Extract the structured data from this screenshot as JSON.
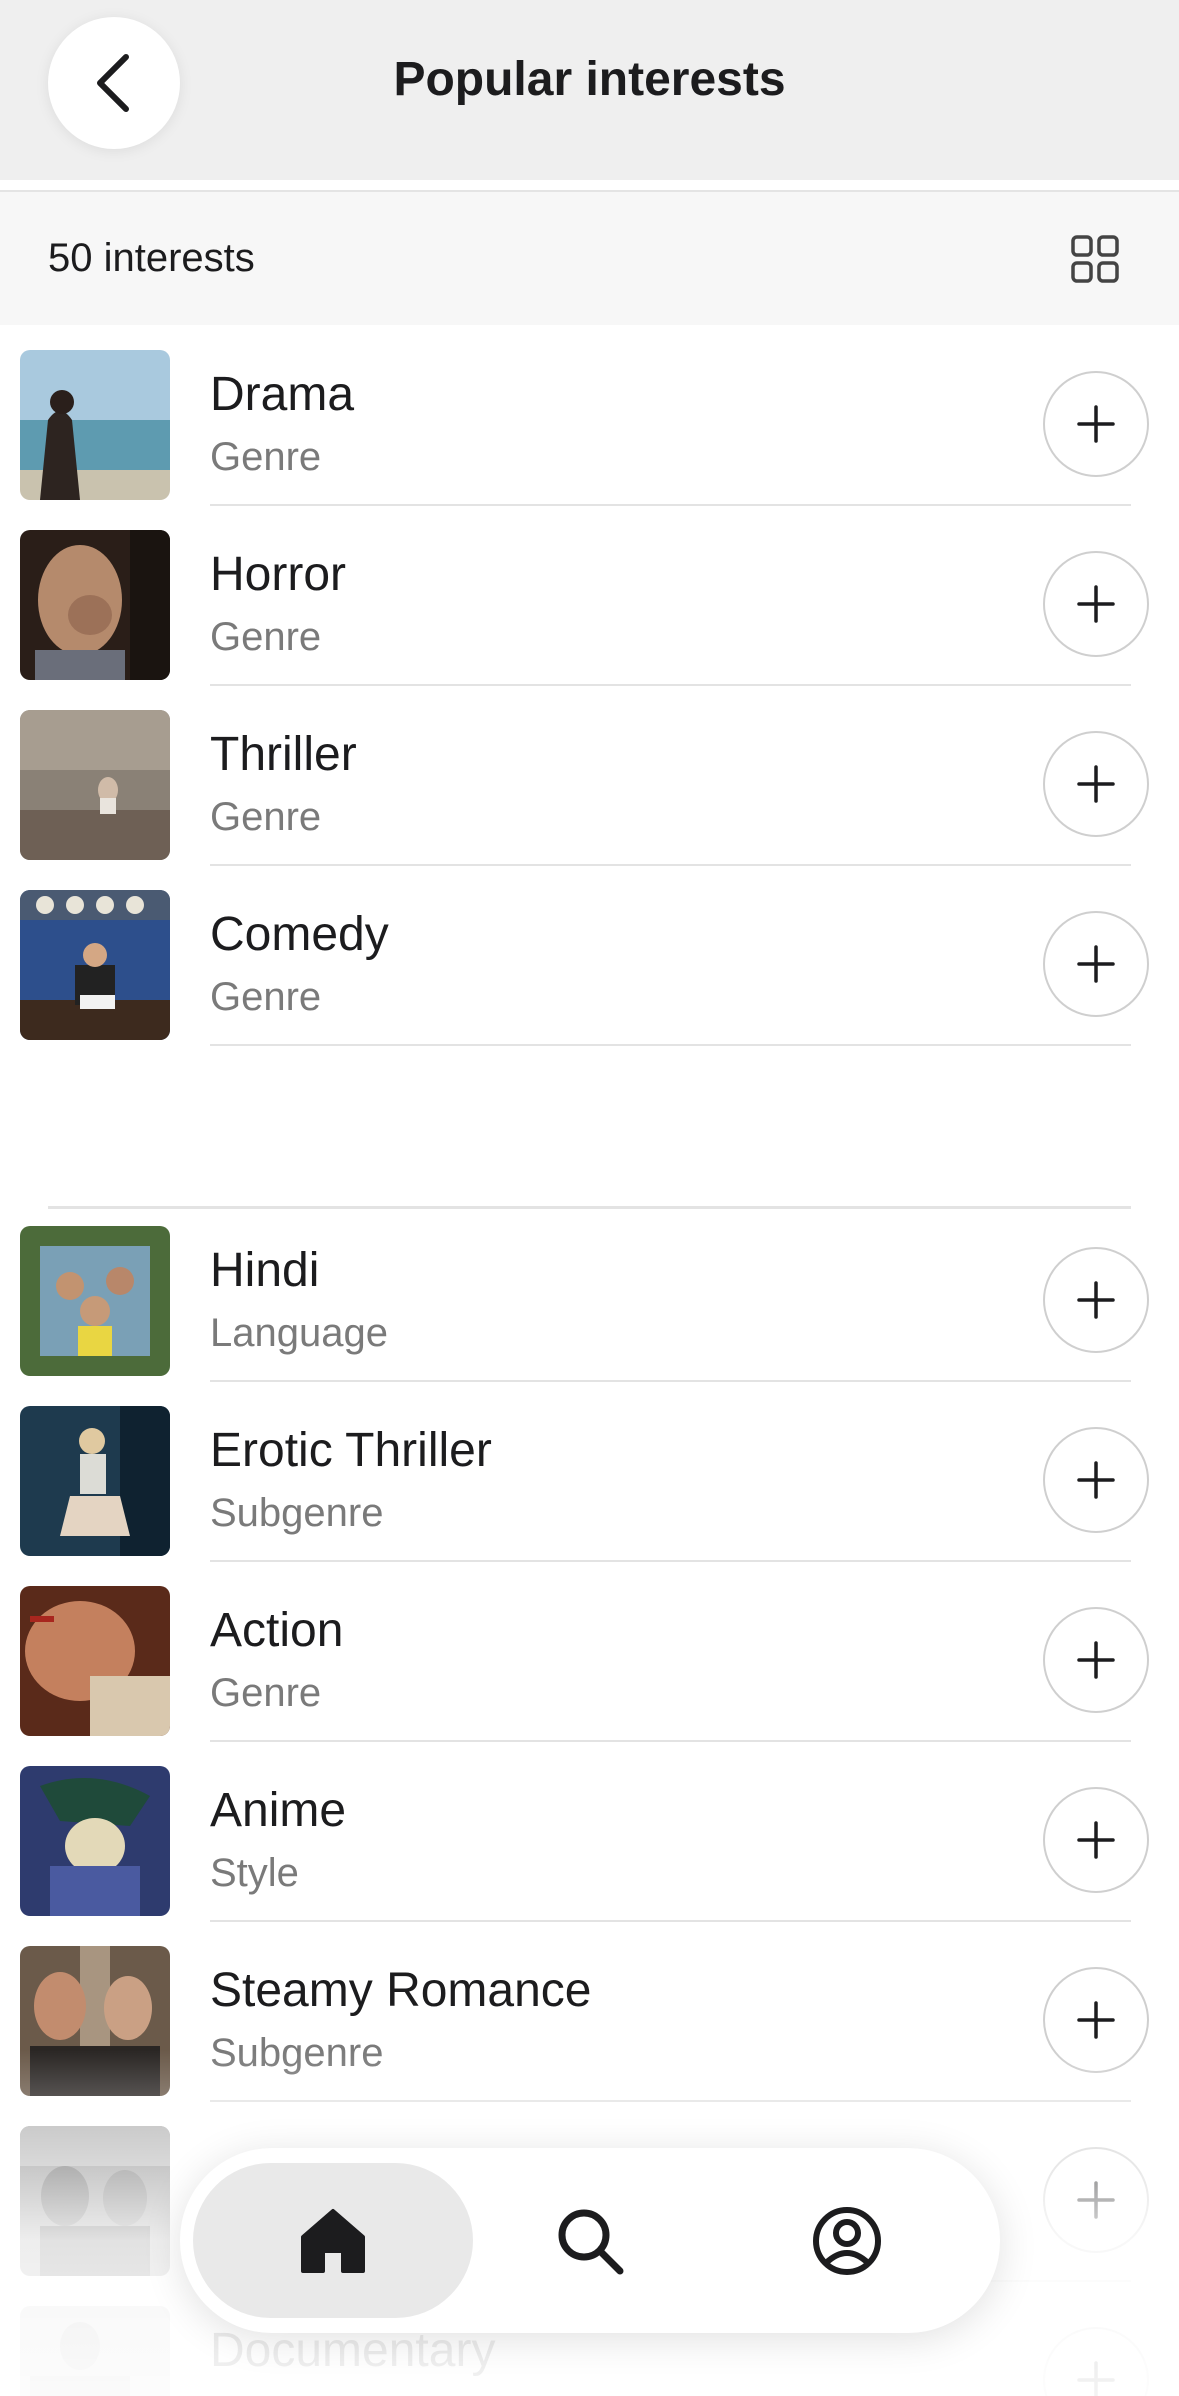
{
  "header": {
    "title": "Popular interests"
  },
  "summary": {
    "count_label": "50 interests"
  },
  "interests": [
    {
      "title": "Drama",
      "subtitle": "Genre"
    },
    {
      "title": "Horror",
      "subtitle": "Genre"
    },
    {
      "title": "Thriller",
      "subtitle": "Genre"
    },
    {
      "title": "Comedy",
      "subtitle": "Genre"
    },
    {
      "title": "Hindi",
      "subtitle": "Language"
    },
    {
      "title": "Erotic Thriller",
      "subtitle": "Subgenre"
    },
    {
      "title": "Action",
      "subtitle": "Genre"
    },
    {
      "title": "Anime",
      "subtitle": "Style"
    },
    {
      "title": "Steamy Romance",
      "subtitle": "Subgenre"
    },
    {
      "title": "",
      "subtitle": ""
    },
    {
      "title": "Documentary",
      "subtitle": ""
    }
  ],
  "icons": {
    "back": "chevron-left-icon",
    "view_toggle": "grid-icon",
    "add": "plus-icon",
    "home": "home-icon",
    "search": "search-icon",
    "profile": "profile-icon"
  },
  "tabbar": {
    "active": "home"
  },
  "colors": {
    "background": "#ffffff",
    "header_bg": "#efefef",
    "subtitle_gray": "#7a7a7a",
    "separator": "#e3e3e3",
    "active_tab_bg": "#e9e9e9"
  }
}
